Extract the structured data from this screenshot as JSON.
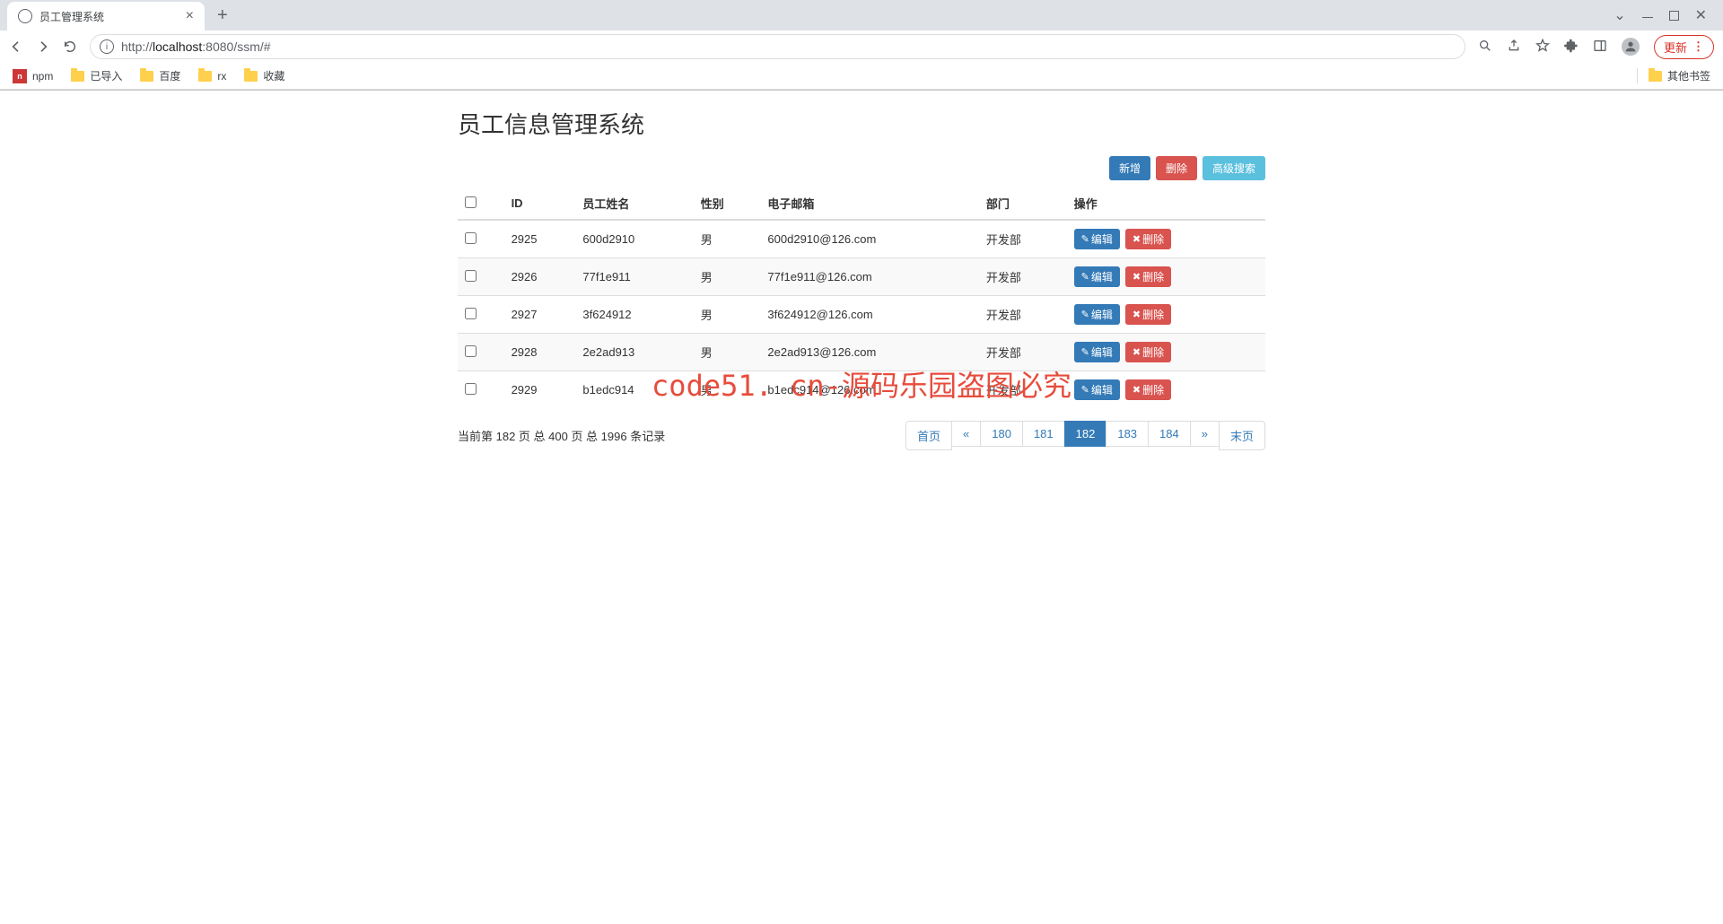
{
  "browser": {
    "tab_title": "员工管理系统",
    "url_prefix": "http://",
    "url_host": "localhost",
    "url_port": ":8080",
    "url_path": "/ssm/#",
    "update_label": "更新",
    "bookmarks": {
      "npm": "npm",
      "imported": "已导入",
      "baidu": "百度",
      "rx": "rx",
      "favorites": "收藏",
      "other": "其他书签"
    }
  },
  "page": {
    "title": "员工信息管理系统",
    "actions": {
      "add": "新增",
      "delete": "删除",
      "search": "高级搜索"
    },
    "columns": {
      "id": "ID",
      "name": "员工姓名",
      "gender": "性别",
      "email": "电子邮箱",
      "dept": "部门",
      "op": "操作"
    },
    "row_actions": {
      "edit": "编辑",
      "delete": "删除"
    },
    "rows": [
      {
        "id": "2925",
        "name": "600d2910",
        "gender": "男",
        "email": "600d2910@126.com",
        "dept": "开发部"
      },
      {
        "id": "2926",
        "name": "77f1e911",
        "gender": "男",
        "email": "77f1e911@126.com",
        "dept": "开发部"
      },
      {
        "id": "2927",
        "name": "3f624912",
        "gender": "男",
        "email": "3f624912@126.com",
        "dept": "开发部"
      },
      {
        "id": "2928",
        "name": "2e2ad913",
        "gender": "男",
        "email": "2e2ad913@126.com",
        "dept": "开发部"
      },
      {
        "id": "2929",
        "name": "b1edc914",
        "gender": "男",
        "email": "b1edc914@126.com",
        "dept": "开发部"
      }
    ],
    "record_info": "当前第 182 页 总 400 页 总 1996 条记录",
    "pagination": {
      "first": "首页",
      "prev": "«",
      "p180": "180",
      "p181": "181",
      "p182": "182",
      "p183": "183",
      "p184": "184",
      "next": "»",
      "last": "末页"
    },
    "watermark": "code51. cn-源码乐园盗图必究"
  }
}
